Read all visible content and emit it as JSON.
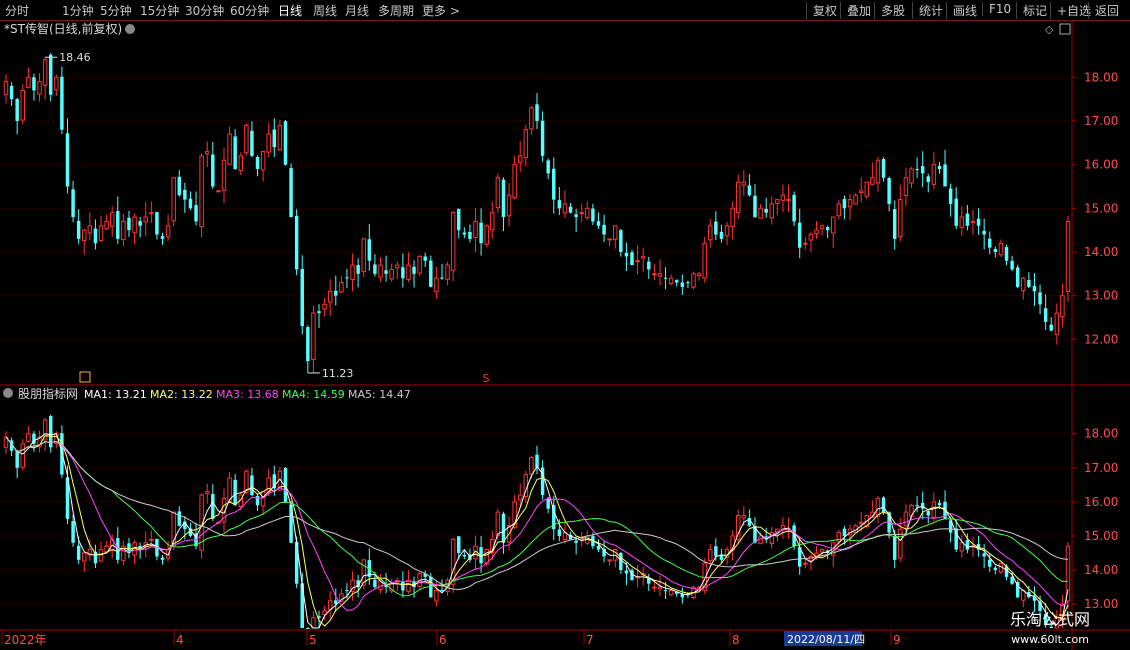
{
  "toolbar": {
    "periods": [
      "分时",
      "1分钟",
      "5分钟",
      "15分钟",
      "30分钟",
      "60分钟",
      "日线",
      "周线",
      "月线",
      "多周期",
      "更多 >"
    ],
    "selected": "日线",
    "right": [
      "复权",
      "叠加",
      "多股",
      "统计",
      "画线",
      "F10",
      "标记",
      "+自选",
      "返回"
    ]
  },
  "main_panel": {
    "title": "*ST传智(日线,前复权)",
    "high_label": "18.46",
    "low_label": "11.23",
    "marker": "S"
  },
  "ma_panel": {
    "title": "股朋指标网",
    "ma": [
      {
        "label": "MA1:",
        "value": "13.21",
        "color": "#ffffff"
      },
      {
        "label": "MA2:",
        "value": "13.22",
        "color": "#ffff66"
      },
      {
        "label": "MA3:",
        "value": "13.68",
        "color": "#ff44ff"
      },
      {
        "label": "MA4:",
        "value": "14.59",
        "color": "#44ff44"
      },
      {
        "label": "MA5:",
        "value": "14.47",
        "color": "#cccccc"
      }
    ]
  },
  "xaxis": {
    "labels": [
      "2022年",
      "4",
      "5",
      "6",
      "7",
      "8",
      "9"
    ],
    "cursor_date": "2022/08/11/四"
  },
  "watermark": {
    "line1": "乐淘公式网",
    "line2": "www.60lt.com"
  },
  "colors": {
    "up": "#ff3232",
    "down": "#54ffff",
    "grid": "#5a0000",
    "axis": "#a00000",
    "text": "#ff4d4d"
  },
  "chart_data": {
    "type": "candlestick",
    "title": "*ST传智(日线,前复权)",
    "yticks_main": [
      12.0,
      13.0,
      14.0,
      15.0,
      16.0,
      17.0,
      18.0
    ],
    "ylim_main": [
      11.0,
      18.9
    ],
    "yticks_ma": [
      13.0,
      14.0,
      15.0,
      16.0,
      17.0,
      18.0
    ],
    "ylim_ma": [
      12.3,
      18.9
    ],
    "annotations": [
      {
        "text": "18.46",
        "type": "high"
      },
      {
        "text": "11.23",
        "type": "low"
      }
    ],
    "series": [
      {
        "name": "price",
        "closes": [
          17.9,
          17.5,
          17.0,
          17.7,
          18.0,
          17.7,
          17.9,
          18.4,
          17.6,
          18.0,
          16.8,
          15.5,
          14.8,
          14.3,
          14.5,
          14.6,
          14.2,
          14.6,
          14.7,
          14.9,
          14.3,
          14.7,
          14.5,
          14.8,
          14.6,
          14.8,
          14.9,
          14.4,
          14.3,
          14.6,
          15.7,
          15.3,
          15.2,
          15.0,
          14.7,
          16.2,
          16.3,
          15.5,
          15.4,
          16.1,
          16.7,
          15.9,
          16.2,
          16.9,
          16.2,
          15.9,
          16.3,
          16.7,
          16.4,
          16.9,
          16.0,
          14.8,
          13.6,
          12.3,
          11.5,
          12.6,
          12.6,
          12.8,
          13.1,
          13.0,
          13.3,
          13.4,
          13.7,
          13.5,
          14.3,
          13.8,
          13.5,
          13.7,
          13.5,
          13.6,
          13.7,
          13.4,
          13.7,
          13.5,
          13.9,
          13.8,
          13.2,
          13.4,
          13.4,
          13.7,
          14.9,
          14.5,
          14.4,
          14.3,
          14.7,
          14.2,
          14.6,
          14.9,
          15.7,
          14.8,
          15.3,
          16.0,
          16.2,
          16.8,
          17.3,
          17.0,
          16.2,
          15.8,
          15.2,
          15.0,
          15.1,
          14.9,
          14.8,
          14.9,
          15.0,
          14.7,
          14.6,
          14.4,
          14.3,
          14.6,
          14.0,
          13.9,
          13.7,
          13.8,
          13.9,
          13.6,
          13.5,
          13.5,
          13.4,
          13.4,
          13.3,
          13.2,
          13.3,
          13.5,
          13.5,
          14.2,
          14.6,
          14.4,
          14.3,
          14.6,
          15.0,
          15.6,
          15.6,
          15.3,
          14.8,
          15.0,
          14.9,
          15.1,
          15.2,
          15.3,
          15.2,
          14.7,
          14.1,
          14.2,
          14.4,
          14.5,
          14.6,
          14.5,
          14.8,
          15.1,
          15.0,
          15.2,
          15.3,
          15.4,
          15.6,
          15.7,
          16.1,
          15.7,
          15.1,
          14.3,
          15.2,
          15.7,
          15.9,
          15.9,
          15.8,
          15.6,
          16.0,
          15.9,
          15.5,
          15.1,
          14.6,
          14.8,
          14.6,
          14.7,
          14.6,
          14.4,
          14.1,
          14.0,
          14.2,
          13.8,
          13.6,
          13.2,
          13.4,
          13.2,
          13.1,
          12.8,
          12.4,
          12.2,
          12.6,
          13.0,
          14.7
        ]
      }
    ]
  }
}
